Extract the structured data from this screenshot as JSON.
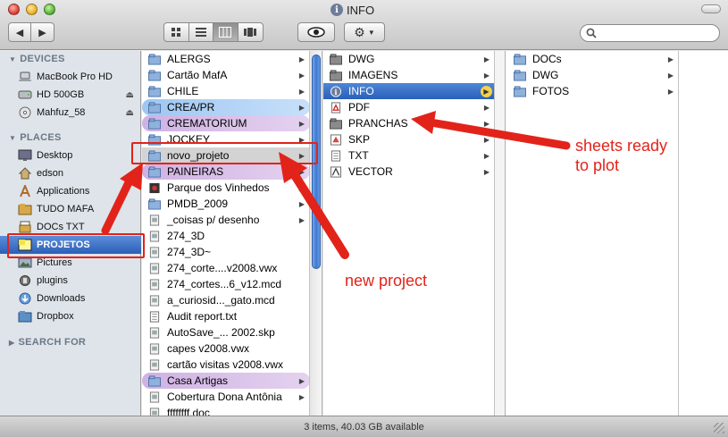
{
  "window": {
    "title": "INFO",
    "status": "3 items, 40.03 GB available"
  },
  "toolbar": {
    "back_icon": "back-arrow-icon",
    "forward_icon": "forward-arrow-icon",
    "views": [
      "icon-view",
      "list-view",
      "column-view",
      "coverflow-view"
    ],
    "active_view": "column-view",
    "search_placeholder": ""
  },
  "sidebar": {
    "devices_label": "DEVICES",
    "places_label": "PLACES",
    "search_label": "SEARCH FOR",
    "devices": [
      {
        "label": "MacBook Pro HD",
        "icon": "laptop-icon",
        "eject": false
      },
      {
        "label": "HD 500GB",
        "icon": "drive-icon",
        "eject": true
      },
      {
        "label": "Mahfuz_58",
        "icon": "disc-icon",
        "eject": true
      }
    ],
    "places": [
      {
        "label": "Desktop",
        "icon": "desktop-icon"
      },
      {
        "label": "edson",
        "icon": "home-icon"
      },
      {
        "label": "Applications",
        "icon": "applications-icon"
      },
      {
        "label": "TUDO MAFA",
        "icon": "folder-icon"
      },
      {
        "label": "DOCs TXT",
        "icon": "document-icon"
      },
      {
        "label": "PROJETOS",
        "icon": "folder-icon",
        "selected": true
      },
      {
        "label": "Pictures",
        "icon": "pictures-icon"
      },
      {
        "label": "plugins",
        "icon": "folder-icon"
      },
      {
        "label": "Downloads",
        "icon": "downloads-icon"
      },
      {
        "label": "Dropbox",
        "icon": "dropbox-icon"
      }
    ]
  },
  "column1": [
    {
      "label": "ALERGS",
      "kind": "folder",
      "arrow": true
    },
    {
      "label": "Cartão MafA",
      "kind": "folder",
      "arrow": true
    },
    {
      "label": "CHILE",
      "kind": "folder",
      "arrow": true
    },
    {
      "label": "CREA/PR",
      "kind": "folder",
      "arrow": true,
      "tag": "blue"
    },
    {
      "label": "CREMATORIUM",
      "kind": "folder",
      "arrow": true,
      "tag": "purple"
    },
    {
      "label": "JOCKEY",
      "kind": "folder",
      "arrow": true
    },
    {
      "label": "novo_projeto",
      "kind": "folder",
      "arrow": true,
      "state": "gray"
    },
    {
      "label": "PAINEIRAS",
      "kind": "folder",
      "arrow": true,
      "tag": "purple"
    },
    {
      "label": "Parque dos Vinhedos",
      "kind": "app",
      "arrow": true
    },
    {
      "label": "PMDB_2009",
      "kind": "folder",
      "arrow": true
    },
    {
      "label": "_coisas p/ desenho",
      "kind": "file",
      "arrow": true
    },
    {
      "label": "274_3D",
      "kind": "file",
      "arrow": false
    },
    {
      "label": "274_3D~",
      "kind": "file",
      "arrow": false
    },
    {
      "label": "274_corte....v2008.vwx",
      "kind": "file",
      "arrow": false
    },
    {
      "label": "274_cortes...6_v12.mcd",
      "kind": "file",
      "arrow": false
    },
    {
      "label": "a_curiosid..._gato.mcd",
      "kind": "file",
      "arrow": false
    },
    {
      "label": "Audit report.txt",
      "kind": "text",
      "arrow": false
    },
    {
      "label": "AutoSave_... 2002.skp",
      "kind": "file",
      "arrow": false
    },
    {
      "label": "capes v2008.vwx",
      "kind": "file",
      "arrow": false
    },
    {
      "label": "cartão visitas v2008.vwx",
      "kind": "file",
      "arrow": false
    },
    {
      "label": "Casa Artigas",
      "kind": "folder",
      "arrow": true,
      "tag": "purple"
    },
    {
      "label": "Cobertura Dona Antônia",
      "kind": "file",
      "arrow": true
    },
    {
      "label": "ffffffff.doc",
      "kind": "file",
      "arrow": false
    }
  ],
  "column2": [
    {
      "label": "DWG",
      "kind": "folder-dark",
      "arrow": true
    },
    {
      "label": "IMAGENS",
      "kind": "folder-dark",
      "arrow": true
    },
    {
      "label": "INFO",
      "kind": "info",
      "arrow": true,
      "state": "selected"
    },
    {
      "label": "PDF",
      "kind": "pdf",
      "arrow": true
    },
    {
      "label": "PRANCHAS",
      "kind": "folder-dark",
      "arrow": true
    },
    {
      "label": "SKP",
      "kind": "skp",
      "arrow": true
    },
    {
      "label": "TXT",
      "kind": "text",
      "arrow": true
    },
    {
      "label": "VECTOR",
      "kind": "vector",
      "arrow": true
    }
  ],
  "column3": [
    {
      "label": "DOCs",
      "kind": "folder",
      "arrow": true
    },
    {
      "label": "DWG",
      "kind": "folder",
      "arrow": true
    },
    {
      "label": "FOTOS",
      "kind": "folder",
      "arrow": true
    }
  ],
  "annotations": {
    "sheets": "sheets ready\nto plot",
    "new_project": "new project"
  },
  "colors": {
    "selection": "#2a61b9",
    "annotation": "#e2231a",
    "tag_blue": "#9ec6f2",
    "tag_purple": "#cfb1e3"
  }
}
